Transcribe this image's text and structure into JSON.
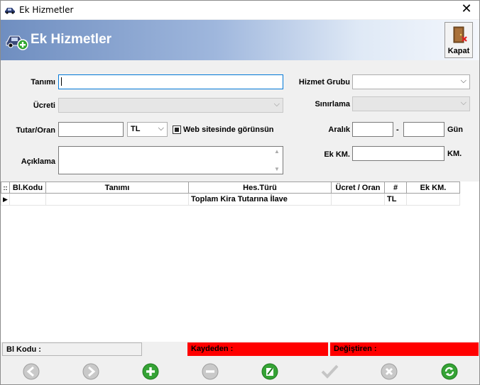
{
  "window": {
    "title": "Ek Hizmetler",
    "close_glyph": "✕"
  },
  "header": {
    "title": "Ek Hizmetler",
    "close_label": "Kapat"
  },
  "form": {
    "tanimi_label": "Tanımı",
    "tanimi_value": "",
    "ucreti_label": "Ücreti",
    "ucreti_value": "",
    "tutar_label": "Tutar/Oran",
    "tutar_value": "",
    "currency_value": "TL",
    "web_label": "Web sitesinde görünsün",
    "web_checked": true,
    "aciklama_label": "Açıklama",
    "aciklama_value": "",
    "hizmet_grubu_label": "Hizmet Grubu",
    "hizmet_grubu_value": "",
    "sinirlama_label": "Sınırlama",
    "sinirlama_value": "",
    "aralik_label": "Aralık",
    "aralik_from": "",
    "aralik_sep": "-",
    "aralik_to": "",
    "gun_label": "Gün",
    "ek_km_label": "Ek KM.",
    "ek_km_value": "",
    "km_label": "KM."
  },
  "grid": {
    "row_marker_header": "::",
    "columns": [
      "Bl.Kodu",
      "Tanımı",
      "Hes.Türü",
      "Ücret / Oran",
      "#",
      "Ek KM."
    ],
    "rows": [
      {
        "bl_kodu": "",
        "tanimi": "",
        "hes_turu": "Toplam Kira Tutarına İlave",
        "ucret_oran": "",
        "currency": "TL",
        "ek_km": ""
      }
    ]
  },
  "status": {
    "bl_kodu": "Bl Kodu :",
    "kaydeden": "Kaydeden :",
    "degistiren": "Değiştiren :",
    "highlight_color": "#ff0000"
  },
  "toolbar": {
    "buttons": [
      "back-icon",
      "forward-icon",
      "add-icon",
      "remove-icon",
      "edit-icon",
      "confirm-icon",
      "cancel-icon",
      "refresh-icon"
    ]
  }
}
